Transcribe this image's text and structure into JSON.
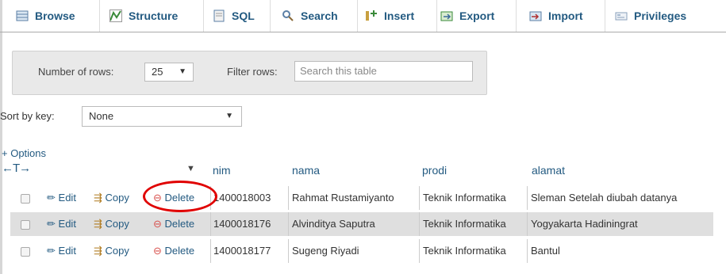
{
  "tabs": [
    {
      "label": "Browse",
      "icon": "browse-icon",
      "active": true
    },
    {
      "label": "Structure",
      "icon": "structure-icon"
    },
    {
      "label": "SQL",
      "icon": "sql-icon"
    },
    {
      "label": "Search",
      "icon": "search-icon"
    },
    {
      "label": "Insert",
      "icon": "insert-icon"
    },
    {
      "label": "Export",
      "icon": "export-icon"
    },
    {
      "label": "Import",
      "icon": "import-icon"
    },
    {
      "label": "Privileges",
      "icon": "privileges-icon"
    }
  ],
  "filter": {
    "rows_label": "Number of rows:",
    "rows_value": "25",
    "filter_label": "Filter rows:",
    "filter_placeholder": "Search this table"
  },
  "sort": {
    "label": "Sort by key:",
    "value": "None"
  },
  "options_label": "+ Options",
  "columns": [
    "nim",
    "nama",
    "prodi",
    "alamat"
  ],
  "actions": {
    "edit": "Edit",
    "copy": "Copy",
    "delete": "Delete"
  },
  "rows": [
    {
      "nim": "1400018003",
      "nama": "Rahmat Rustamiyanto",
      "prodi": "Teknik Informatika",
      "alamat": "Sleman Setelah diubah datanya"
    },
    {
      "nim": "1400018176",
      "nama": "Alvinditya Saputra",
      "prodi": "Teknik Informatika",
      "alamat": "Yogyakarta Hadiningrat"
    },
    {
      "nim": "1400018177",
      "nama": "Sugeng Riyadi",
      "prodi": "Teknik Informatika",
      "alamat": "Bantul"
    }
  ],
  "colors": {
    "link": "#235a81",
    "highlight": "#e00000",
    "row_alt": "#dfdfdf"
  }
}
